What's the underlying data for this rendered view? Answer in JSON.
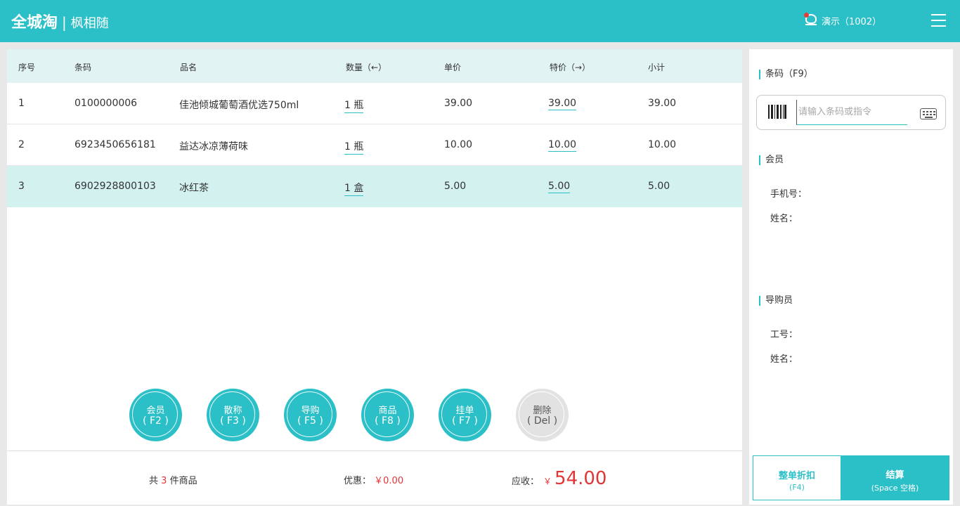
{
  "header": {
    "brand": "全城淘",
    "separator": "|",
    "store": "枫相随",
    "user_label": "演示（1002）",
    "icons": {
      "user": "user-avatar-icon",
      "menu": "hamburger-menu-icon"
    },
    "accent_color": "#2bbfc7"
  },
  "table": {
    "columns": [
      "序号",
      "条码",
      "品名",
      "数量（←）",
      "单价",
      "特价（→）",
      "小计"
    ],
    "rows": [
      {
        "no": "1",
        "barcode": "0100000006",
        "name": "佳池倾城葡萄酒优选750ml",
        "qty": "1 瓶",
        "price": "39.00",
        "special": "39.00",
        "subtotal": "39.00"
      },
      {
        "no": "2",
        "barcode": "6923450656181",
        "name": "益达冰凉薄荷味",
        "qty": "1 瓶",
        "price": "10.00",
        "special": "10.00",
        "subtotal": "10.00"
      },
      {
        "no": "3",
        "barcode": "6902928800103",
        "name": "冰红茶",
        "qty": "1 盒",
        "price": "5.00",
        "special": "5.00",
        "subtotal": "5.00"
      }
    ],
    "selected_row": 3
  },
  "actions": [
    {
      "label": "会员",
      "key": "( F2 )"
    },
    {
      "label": "散称",
      "key": "( F3 )"
    },
    {
      "label": "导购",
      "key": "( F5 )"
    },
    {
      "label": "商品",
      "key": "( F8 )"
    },
    {
      "label": "挂单",
      "key": "( F7 )"
    },
    {
      "label": "删除",
      "key": "( Del )"
    }
  ],
  "footer": {
    "count_prefix": "共",
    "count": "3",
    "count_suffix": "件商品",
    "discount_label": "优惠：",
    "discount_value": "￥0.00",
    "receivable_label": "应收：",
    "currency": "￥",
    "receivable_value": "54.00",
    "highlight_color": "#e23535"
  },
  "side": {
    "barcode_section": "条码（F9）",
    "barcode_placeholder": "请输入条码或指令",
    "member_section": "会员",
    "phone_label": "手机号：",
    "member_name_label": "姓名：",
    "guide_section": "导购员",
    "staff_id_label": "工号：",
    "guide_name_label": "姓名：",
    "icons": {
      "barcode": "barcode-icon",
      "keyboard": "keyboard-icon"
    }
  },
  "buttons": {
    "discount_label": "整单折扣",
    "discount_key": "(F4)",
    "checkout_label": "结算",
    "checkout_key": "(Space 空格)"
  }
}
